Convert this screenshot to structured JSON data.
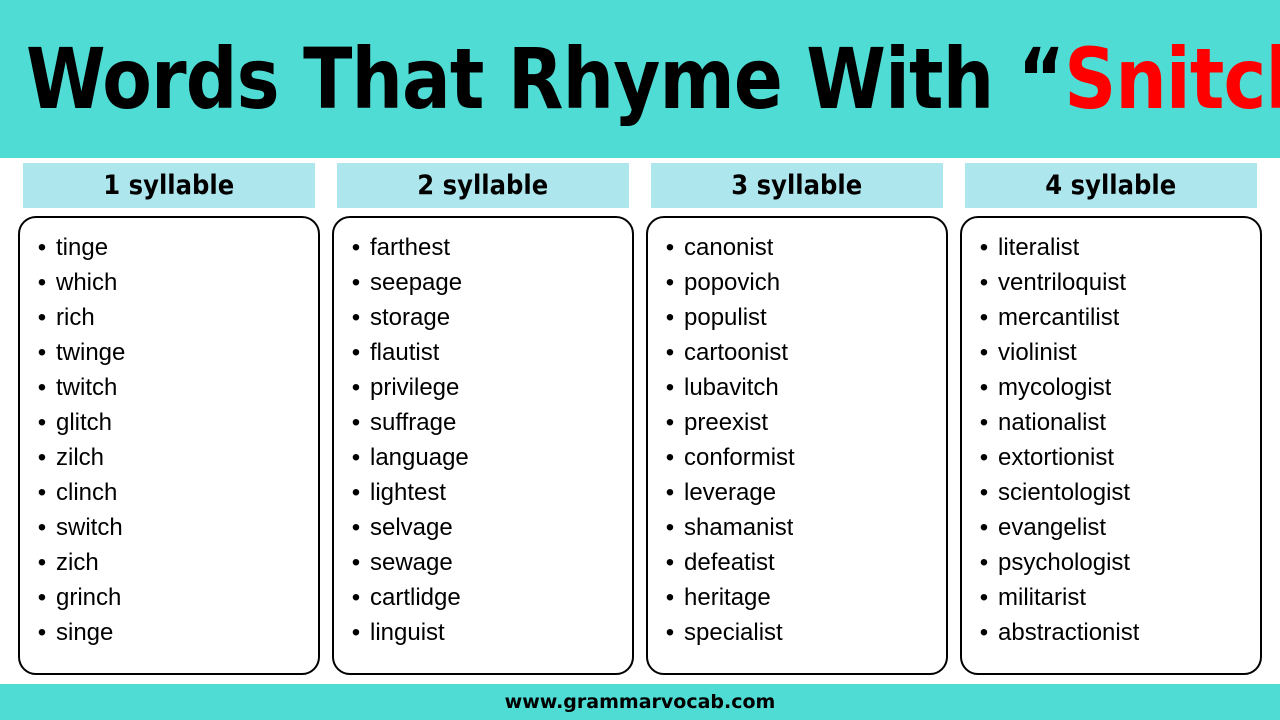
{
  "header": {
    "title_prefix": "Words That Rhyme With ",
    "open_quote": "“",
    "accent_word": "Snitch",
    "close_quote": "”",
    "background_color": "#4fdcd4",
    "accent_color": "#ff0000",
    "text_color": "#000000"
  },
  "bullet_glyph": "•",
  "columns": [
    {
      "header": "1 syllable",
      "words": [
        "tinge",
        "which",
        "rich",
        "twinge",
        "twitch",
        "glitch",
        "zilch",
        "clinch",
        "switch",
        "zich",
        "grinch",
        "singe"
      ]
    },
    {
      "header": "2 syllable",
      "words": [
        "farthest",
        "seepage",
        "storage",
        "flautist",
        "privilege",
        "suffrage",
        "language",
        "lightest",
        "selvage",
        "sewage",
        "cartlidge",
        "linguist"
      ]
    },
    {
      "header": "3 syllable",
      "words": [
        "canonist",
        "popovich",
        "populist",
        "cartoonist",
        "lubavitch",
        "preexist",
        "conformist",
        "leverage",
        "shamanist",
        "defeatist",
        "heritage",
        "specialist"
      ]
    },
    {
      "header": "4 syllable",
      "words": [
        "literalist",
        "ventriloquist",
        "mercantilist",
        "violinist",
        "mycologist",
        "nationalist",
        "extortionist",
        "scientologist",
        "evangelist",
        "psychologist",
        "militarist",
        "abstractionist"
      ]
    }
  ],
  "column_header_background": "#aee6ee",
  "footer": {
    "website": "www.grammarvocab.com",
    "background_color": "#4fdcd4",
    "text_color": "#000000"
  }
}
